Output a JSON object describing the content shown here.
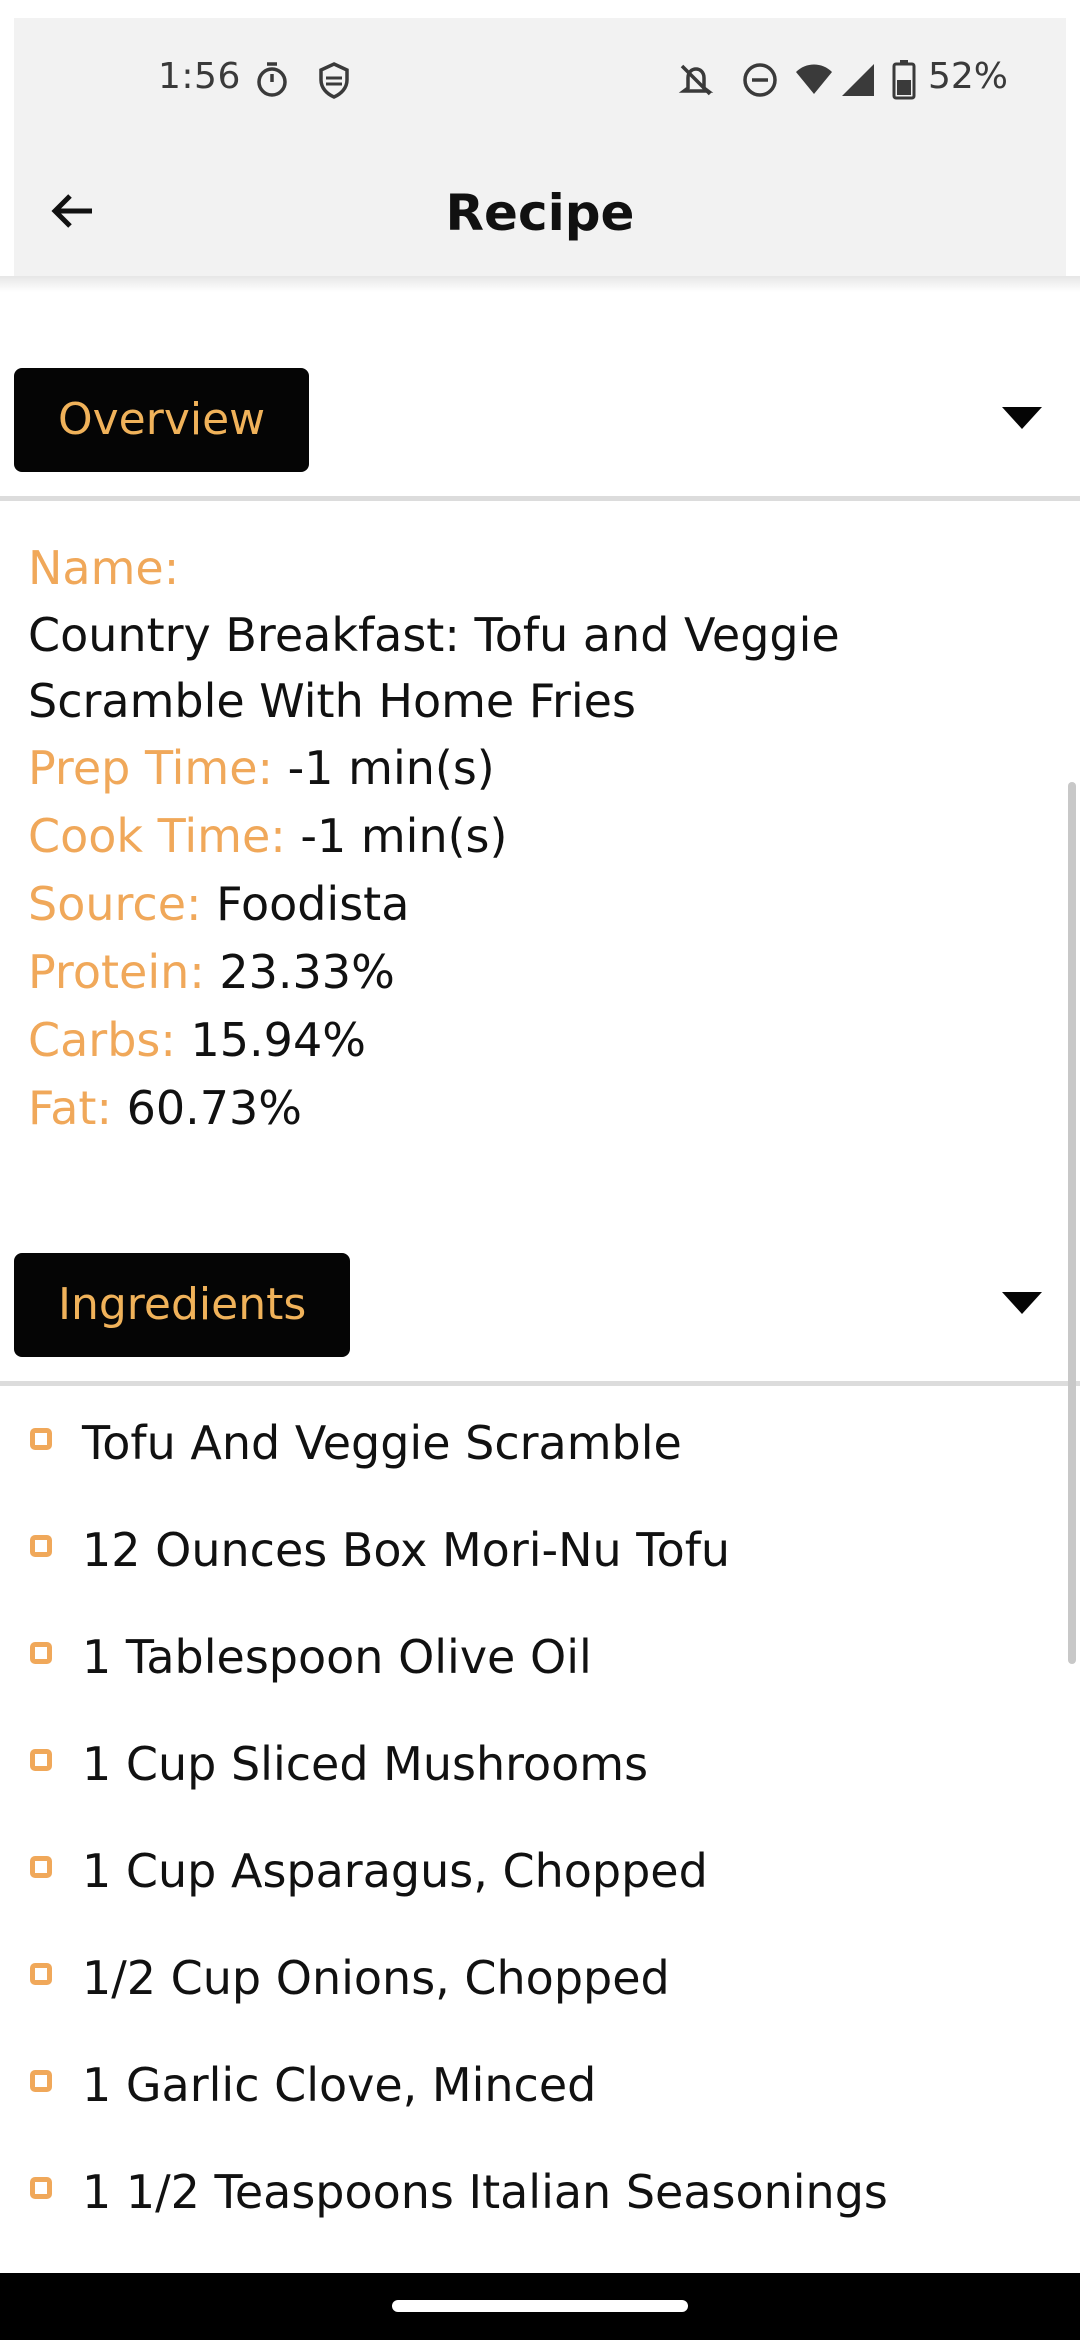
{
  "status_bar": {
    "time": "1:56",
    "battery_percent": "52%",
    "icons": [
      "timer-icon",
      "shield-icon",
      "notifications-off-icon",
      "do-not-disturb-icon",
      "wifi-icon",
      "cellular-signal-icon",
      "battery-icon"
    ]
  },
  "app_bar": {
    "title": "Recipe",
    "back_icon": "arrow-back-icon"
  },
  "overview": {
    "section_label": "Overview",
    "name_label": "Name:",
    "name_value": "Country Breakfast: Tofu and Veggie Scramble With Home Fries",
    "prep_time_label": "Prep Time:",
    "prep_time_value": "-1 min(s)",
    "cook_time_label": "Cook Time:",
    "cook_time_value": "-1 min(s)",
    "source_label": "Source:",
    "source_value": "Foodista",
    "protein_label": "Protein:",
    "protein_value": "23.33%",
    "carbs_label": "Carbs:",
    "carbs_value": "15.94%",
    "fat_label": "Fat:",
    "fat_value": "60.73%"
  },
  "ingredients": {
    "section_label": "Ingredients",
    "items": [
      "Tofu And Veggie Scramble",
      "12 Ounces Box Mori-Nu Tofu",
      "1 Tablespoon Olive Oil",
      "1 Cup Sliced Mushrooms",
      "1 Cup Asparagus, Chopped",
      "1/2 Cup Onions, Chopped",
      "1 Garlic Clove, Minced",
      "1 1/2 Teaspoons Italian Seasonings"
    ]
  },
  "colors": {
    "accent": "#f0a85a",
    "chip_background": "#050505",
    "app_bar_background": "#f2f2f2"
  }
}
